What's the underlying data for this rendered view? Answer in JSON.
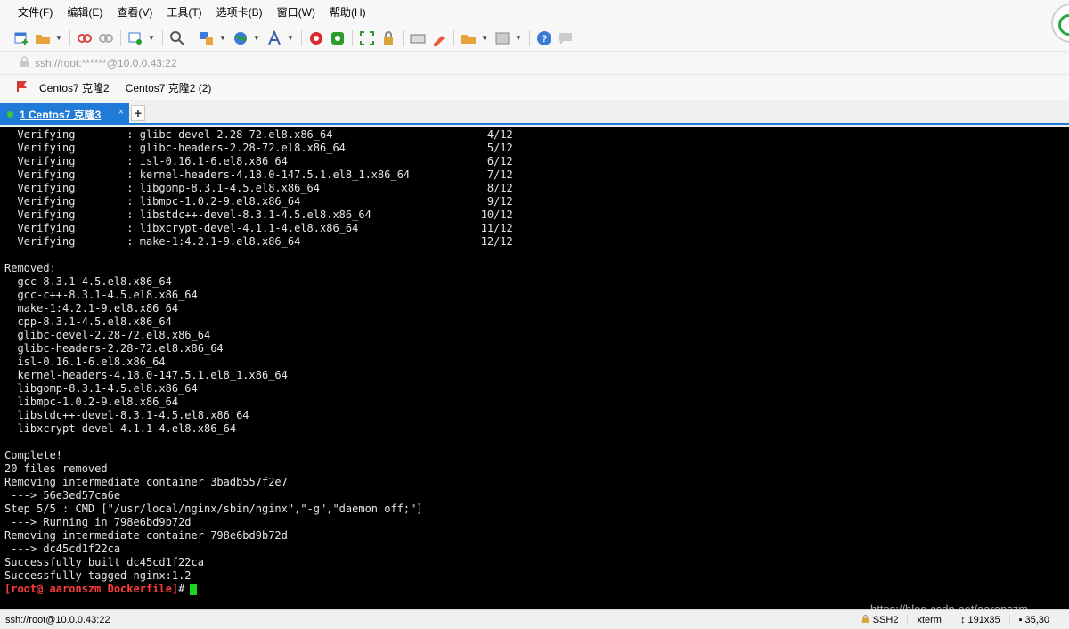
{
  "menu": [
    "文件(F)",
    "编辑(E)",
    "查看(V)",
    "工具(T)",
    "选项卡(B)",
    "窗口(W)",
    "帮助(H)"
  ],
  "toolbar": {
    "icons": [
      "new-session-icon",
      "open-folder-icon",
      "disconnect-icon",
      "reconnect-icon",
      "sftp-icon",
      "find-icon",
      "transfer-icon",
      "globe-icon",
      "font-icon",
      "xftp-icon",
      "xagent-icon",
      "fullscreen-icon",
      "lock-icon",
      "keyboard-icon",
      "highlight-icon",
      "new-tab-icon",
      "layout-icon",
      "help-icon",
      "chat-icon"
    ]
  },
  "address": {
    "text": "ssh://root:******@10.0.0.43:22"
  },
  "bookmarks": [
    "Centos7 克隆2",
    "Centos7 克隆2 (2)"
  ],
  "tab": {
    "label": "1 Centos7 克隆3",
    "close": "×",
    "add": "+"
  },
  "terminal": {
    "lines": [
      "  Verifying        : glibc-devel-2.28-72.el8.x86_64                        4/12",
      "  Verifying        : glibc-headers-2.28-72.el8.x86_64                      5/12",
      "  Verifying        : isl-0.16.1-6.el8.x86_64                               6/12",
      "  Verifying        : kernel-headers-4.18.0-147.5.1.el8_1.x86_64            7/12",
      "  Verifying        : libgomp-8.3.1-4.5.el8.x86_64                          8/12",
      "  Verifying        : libmpc-1.0.2-9.el8.x86_64                             9/12",
      "  Verifying        : libstdc++-devel-8.3.1-4.5.el8.x86_64                 10/12",
      "  Verifying        : libxcrypt-devel-4.1.1-4.el8.x86_64                   11/12",
      "  Verifying        : make-1:4.2.1-9.el8.x86_64                            12/12",
      "",
      "Removed:",
      "  gcc-8.3.1-4.5.el8.x86_64",
      "  gcc-c++-8.3.1-4.5.el8.x86_64",
      "  make-1:4.2.1-9.el8.x86_64",
      "  cpp-8.3.1-4.5.el8.x86_64",
      "  glibc-devel-2.28-72.el8.x86_64",
      "  glibc-headers-2.28-72.el8.x86_64",
      "  isl-0.16.1-6.el8.x86_64",
      "  kernel-headers-4.18.0-147.5.1.el8_1.x86_64",
      "  libgomp-8.3.1-4.5.el8.x86_64",
      "  libmpc-1.0.2-9.el8.x86_64",
      "  libstdc++-devel-8.3.1-4.5.el8.x86_64",
      "  libxcrypt-devel-4.1.1-4.el8.x86_64",
      "",
      "Complete!",
      "20 files removed",
      "Removing intermediate container 3badb557f2e7",
      " ---> 56e3ed57ca6e",
      "Step 5/5 : CMD [\"/usr/local/nginx/sbin/nginx\",\"-g\",\"daemon off;\"]",
      " ---> Running in 798e6bd9b72d",
      "Removing intermediate container 798e6bd9b72d",
      " ---> dc45cd1f22ca",
      "Successfully built dc45cd1f22ca",
      "Successfully tagged nginx:1.2"
    ],
    "prompt": "[root@ aaronszm Dockerfile]",
    "prompt_suffix": "#"
  },
  "watermark": "https://blog.csdn.net/aaronszm",
  "status": {
    "connection": "ssh://root@10.0.0.43:22",
    "protocol": "SSH2",
    "terminal_type": "xterm",
    "size": "191x35",
    "cursor_pos": "35,30"
  },
  "colors": {
    "tab_active": "#1f7ad8",
    "prompt": "#ff3b3b",
    "cursor": "#1bd61b",
    "terminal_bg": "#000000"
  }
}
